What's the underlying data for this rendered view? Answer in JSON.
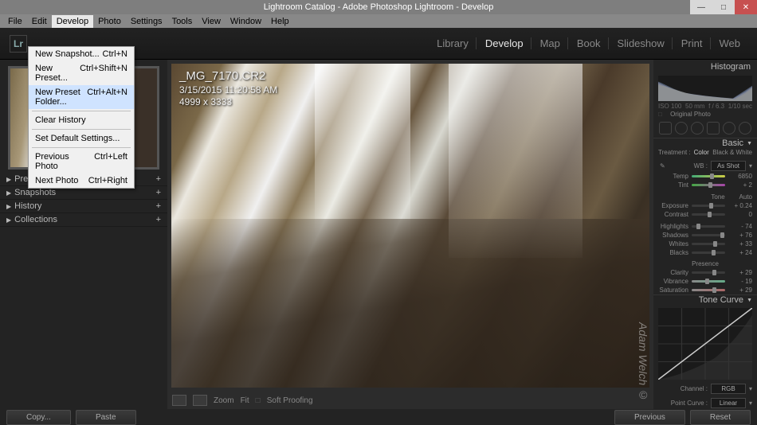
{
  "window": {
    "title": "Lightroom Catalog - Adobe Photoshop Lightroom - Develop"
  },
  "menubar": [
    "File",
    "Edit",
    "Develop",
    "Photo",
    "Settings",
    "Tools",
    "View",
    "Window",
    "Help"
  ],
  "dropdown": {
    "items": [
      {
        "label": "New Snapshot...",
        "shortcut": "Ctrl+N"
      },
      {
        "label": "New Preset...",
        "shortcut": "Ctrl+Shift+N"
      },
      {
        "label": "New Preset Folder...",
        "shortcut": "Ctrl+Alt+N",
        "hl": true
      },
      {
        "sep": true
      },
      {
        "label": "Clear History",
        "shortcut": ""
      },
      {
        "sep": true
      },
      {
        "label": "Set Default Settings...",
        "shortcut": ""
      },
      {
        "sep": true
      },
      {
        "label": "Previous Photo",
        "shortcut": "Ctrl+Left"
      },
      {
        "label": "Next Photo",
        "shortcut": "Ctrl+Right"
      }
    ]
  },
  "modules": [
    "Library",
    "Develop",
    "Map",
    "Book",
    "Slideshow",
    "Print",
    "Web"
  ],
  "active_module": "Develop",
  "left_panels": [
    "Presets",
    "Snapshots",
    "History",
    "Collections"
  ],
  "image": {
    "filename": "_MG_7170.CR2",
    "datetime": "3/15/2015 11:20:58 AM",
    "dims": "4999 x 3333"
  },
  "toolbar": {
    "zoom": "Zoom",
    "fit": "Fit",
    "softproof": "Soft Proofing"
  },
  "histogram": {
    "title": "Histogram",
    "iso": "ISO 100",
    "focal": "50 mm",
    "aperture": "f / 6.3",
    "shutter": "1/10 sec",
    "orig": "Original Photo"
  },
  "basic": {
    "title": "Basic",
    "treatment": "Treatment :",
    "color": "Color",
    "bw": "Black & White",
    "wb": "WB :",
    "wb_val": "As Shot",
    "temp": "Temp",
    "temp_val": "6850",
    "tint": "Tint",
    "tint_val": "+ 2",
    "tone": "Tone",
    "auto": "Auto",
    "exposure": "Exposure",
    "exposure_val": "+ 0.24",
    "contrast": "Contrast",
    "contrast_val": "0",
    "highlights": "Highlights",
    "highlights_val": "- 74",
    "shadows": "Shadows",
    "shadows_val": "+ 76",
    "whites": "Whites",
    "whites_val": "+ 33",
    "blacks": "Blacks",
    "blacks_val": "+ 24",
    "presence": "Presence",
    "clarity": "Clarity",
    "clarity_val": "+ 29",
    "vibrance": "Vibrance",
    "vibrance_val": "- 19",
    "saturation": "Saturation",
    "saturation_val": "+ 29"
  },
  "tonecurve": {
    "title": "Tone Curve",
    "channel": "Channel :",
    "rgb": "RGB",
    "pointcurve": "Point Curve :",
    "linear": "Linear"
  },
  "buttons": {
    "copy": "Copy...",
    "paste": "Paste",
    "previous": "Previous",
    "reset": "Reset"
  },
  "watermark": "Adam Welch ©"
}
